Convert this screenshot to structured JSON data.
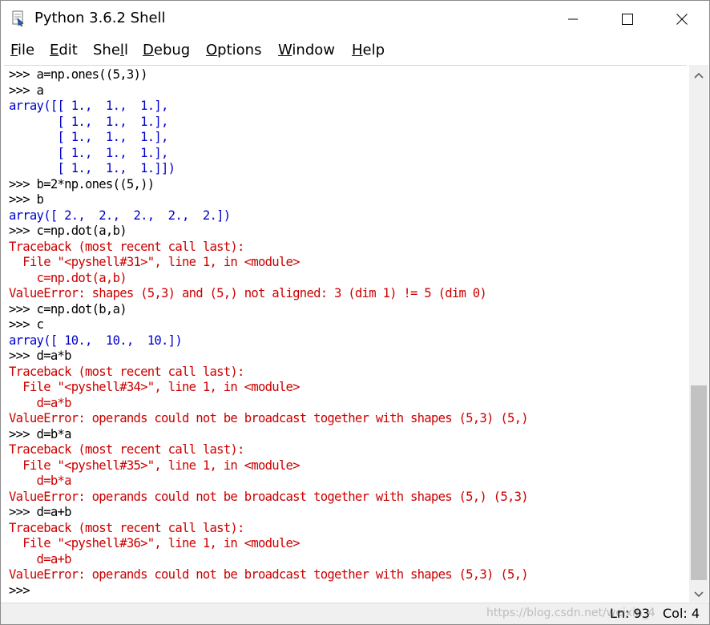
{
  "window": {
    "title": "Python 3.6.2 Shell",
    "icon": "python-idle-icon",
    "controls": [
      "minimize-icon",
      "maximize-icon",
      "close-icon"
    ]
  },
  "menu": [
    {
      "key": "F",
      "rest": "ile"
    },
    {
      "key": "E",
      "rest": "dit"
    },
    {
      "pre": "She",
      "key": "l",
      "rest": "l"
    },
    {
      "key": "D",
      "rest": "ebug"
    },
    {
      "key": "O",
      "rest": "ptions"
    },
    {
      "key": "W",
      "rest": "indow"
    },
    {
      "key": "H",
      "rest": "elp"
    }
  ],
  "shell_lines": [
    {
      "text": ">>> a=np.ones((5,3))",
      "kind": "in"
    },
    {
      "text": ">>> a",
      "kind": "in"
    },
    {
      "text": "array([[ 1.,  1.,  1.],",
      "kind": "out"
    },
    {
      "text": "       [ 1.,  1.,  1.],",
      "kind": "out"
    },
    {
      "text": "       [ 1.,  1.,  1.],",
      "kind": "out"
    },
    {
      "text": "       [ 1.,  1.,  1.],",
      "kind": "out"
    },
    {
      "text": "       [ 1.,  1.,  1.]])",
      "kind": "out"
    },
    {
      "text": ">>> b=2*np.ones((5,))",
      "kind": "in"
    },
    {
      "text": ">>> b",
      "kind": "in"
    },
    {
      "text": "array([ 2.,  2.,  2.,  2.,  2.])",
      "kind": "out"
    },
    {
      "text": ">>> c=np.dot(a,b)",
      "kind": "in"
    },
    {
      "text": "Traceback (most recent call last):",
      "kind": "err"
    },
    {
      "text": "  File \"<pyshell#31>\", line 1, in <module>",
      "kind": "err"
    },
    {
      "text": "    c=np.dot(a,b)",
      "kind": "err"
    },
    {
      "text": "ValueError: shapes (5,3) and (5,) not aligned: 3 (dim 1) != 5 (dim 0)",
      "kind": "err"
    },
    {
      "text": ">>> c=np.dot(b,a)",
      "kind": "in"
    },
    {
      "text": ">>> c",
      "kind": "in"
    },
    {
      "text": "array([ 10.,  10.,  10.])",
      "kind": "out"
    },
    {
      "text": ">>> d=a*b",
      "kind": "in"
    },
    {
      "text": "Traceback (most recent call last):",
      "kind": "err"
    },
    {
      "text": "  File \"<pyshell#34>\", line 1, in <module>",
      "kind": "err"
    },
    {
      "text": "    d=a*b",
      "kind": "err"
    },
    {
      "text": "ValueError: operands could not be broadcast together with shapes (5,3) (5,)",
      "kind": "err"
    },
    {
      "text": ">>> d=b*a",
      "kind": "in"
    },
    {
      "text": "Traceback (most recent call last):",
      "kind": "err"
    },
    {
      "text": "  File \"<pyshell#35>\", line 1, in <module>",
      "kind": "err"
    },
    {
      "text": "    d=b*a",
      "kind": "err"
    },
    {
      "text": "ValueError: operands could not be broadcast together with shapes (5,) (5,3)",
      "kind": "err"
    },
    {
      "text": ">>> d=a+b",
      "kind": "in"
    },
    {
      "text": "Traceback (most recent call last):",
      "kind": "err"
    },
    {
      "text": "  File \"<pyshell#36>\", line 1, in <module>",
      "kind": "err"
    },
    {
      "text": "    d=a+b",
      "kind": "err"
    },
    {
      "text": "ValueError: operands could not be broadcast together with shapes (5,3) (5,)",
      "kind": "err"
    },
    {
      "text": ">>> ",
      "kind": "in"
    }
  ],
  "colors": {
    "input": "#000000",
    "output": "#0000cc",
    "error": "#cc0000"
  },
  "scrollbar": {
    "up_icon": "scroll-up-arrow-icon",
    "down_icon": "scroll-down-arrow-icon"
  },
  "status": {
    "watermark": "https://blog.csdn.net/weixin_4",
    "ln": "Ln: 93",
    "col": "Col: 4"
  }
}
